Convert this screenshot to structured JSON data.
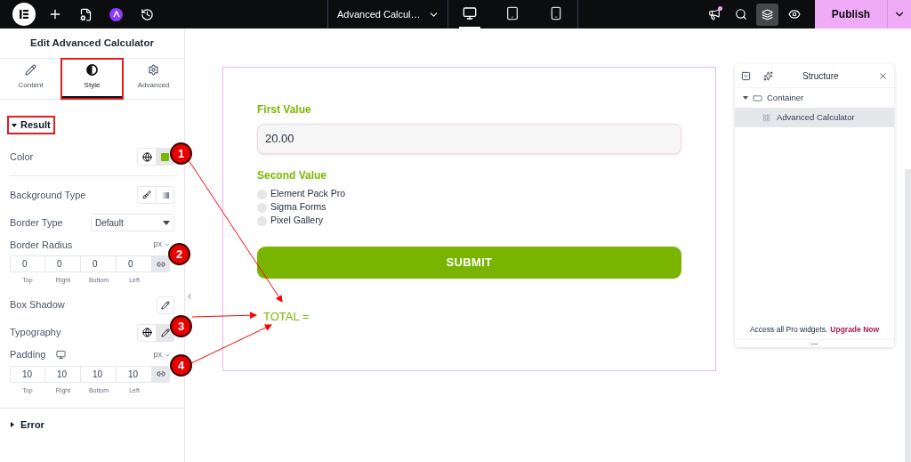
{
  "topbar": {
    "document_title": "Advanced Calcul…",
    "devices": [
      {
        "kind": "desktop",
        "selected": true
      },
      {
        "kind": "tablet",
        "selected": false
      },
      {
        "kind": "mobile",
        "selected": false
      }
    ],
    "structure_on": true,
    "publish": "Publish"
  },
  "panel": {
    "title": "Edit Advanced Calculator",
    "tabs": [
      {
        "kind": "content",
        "label": "Content",
        "selected": false,
        "highlighted": false
      },
      {
        "kind": "style",
        "label": "Style",
        "selected": true,
        "highlighted": true
      },
      {
        "kind": "advanced",
        "label": "Advanced",
        "selected": false,
        "highlighted": false
      }
    ],
    "result": {
      "title": "Result",
      "expanded": true,
      "highlighted": true,
      "rows": [
        {
          "kind": "color",
          "label": "Color"
        },
        {
          "kind": "background",
          "label": "Background Type"
        },
        {
          "kind": "select",
          "label": "Border Type",
          "value": "Default"
        },
        {
          "kind": "dimensions",
          "label": "Border Radius",
          "unit": "px",
          "linked": true,
          "responsive": false,
          "values": [
            {
              "value": "0",
              "label": "Top"
            },
            {
              "value": "0",
              "label": "Right"
            },
            {
              "value": "0",
              "label": "Bottom"
            },
            {
              "value": "0",
              "label": "Left"
            }
          ]
        },
        {
          "kind": "popover",
          "label": "Box Shadow"
        },
        {
          "kind": "typography",
          "label": "Typography"
        },
        {
          "kind": "dimensions",
          "label": "Padding",
          "unit": "px",
          "linked": true,
          "responsive": true,
          "values": [
            {
              "value": "10",
              "label": "Top"
            },
            {
              "value": "10",
              "label": "Right"
            },
            {
              "value": "10",
              "label": "Bottom"
            },
            {
              "value": "10",
              "label": "Left"
            }
          ]
        }
      ]
    },
    "error": {
      "title": "Error",
      "expanded": false
    }
  },
  "form": {
    "first_label": "First Value",
    "first_value": "20.00",
    "second_label": "Second Value",
    "options": [
      {
        "label": "Element Pack Pro",
        "selected": false
      },
      {
        "label": "Sigma Forms",
        "selected": false
      },
      {
        "label": "Pixel Gallery",
        "selected": false
      }
    ],
    "submit": "SUBMIT",
    "total": "TOTAL ="
  },
  "structure": {
    "title": "Structure",
    "tree": [
      {
        "label": "Container",
        "expanded": true,
        "selected": false,
        "children": [
          {
            "label": "Advanced Calculator",
            "selected": true
          }
        ]
      }
    ],
    "promo": "Access all Pro widgets.",
    "link": "Upgrade Now"
  },
  "annotations": [
    {
      "number": "1"
    },
    {
      "number": "2"
    },
    {
      "number": "3"
    },
    {
      "number": "4"
    }
  ]
}
